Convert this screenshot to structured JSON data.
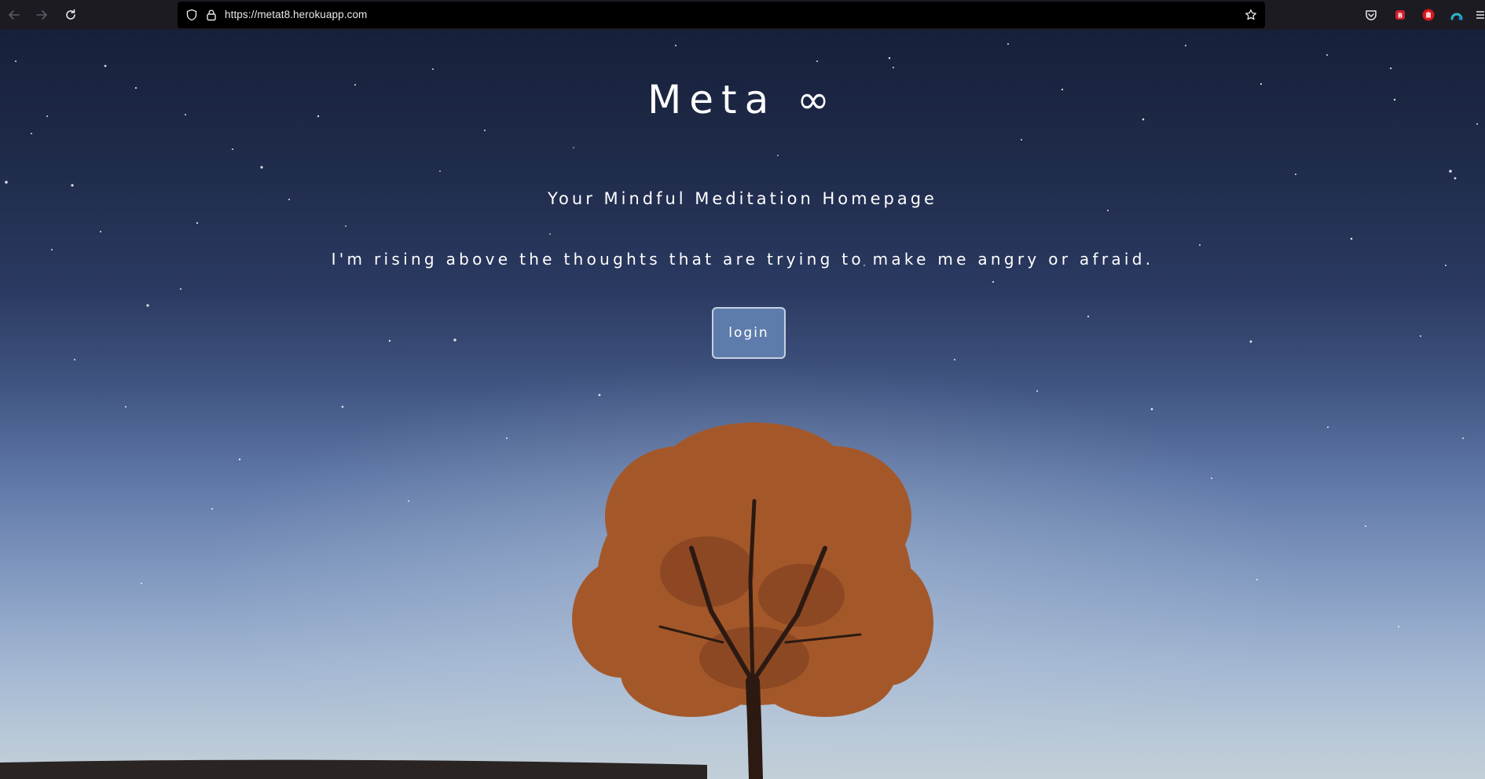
{
  "browser": {
    "url": "https://metat8.herokuapp.com",
    "icons": {
      "back": "arrow-left-icon",
      "forward": "arrow-right-icon",
      "reload": "reload-icon",
      "tracking": "shield-icon",
      "security": "lock-icon",
      "bookmark": "star-icon"
    },
    "extensions": [
      "pocket-icon",
      "b-extension-icon",
      "hand-extension-icon",
      "arc-extension-icon",
      "menu-icon"
    ]
  },
  "page": {
    "title": "Meta ∞",
    "subtitle": "Your Mindful Meditation Homepage",
    "quote": "I'm rising above the thoughts that are trying to make me angry or afraid.",
    "login_label": "login"
  },
  "colors": {
    "sky_top": "#17203a",
    "sky_bottom": "#c3cfd8",
    "button_bg": "#5e7cab",
    "tree_foliage": "#a4582a",
    "text": "#ffffff"
  }
}
